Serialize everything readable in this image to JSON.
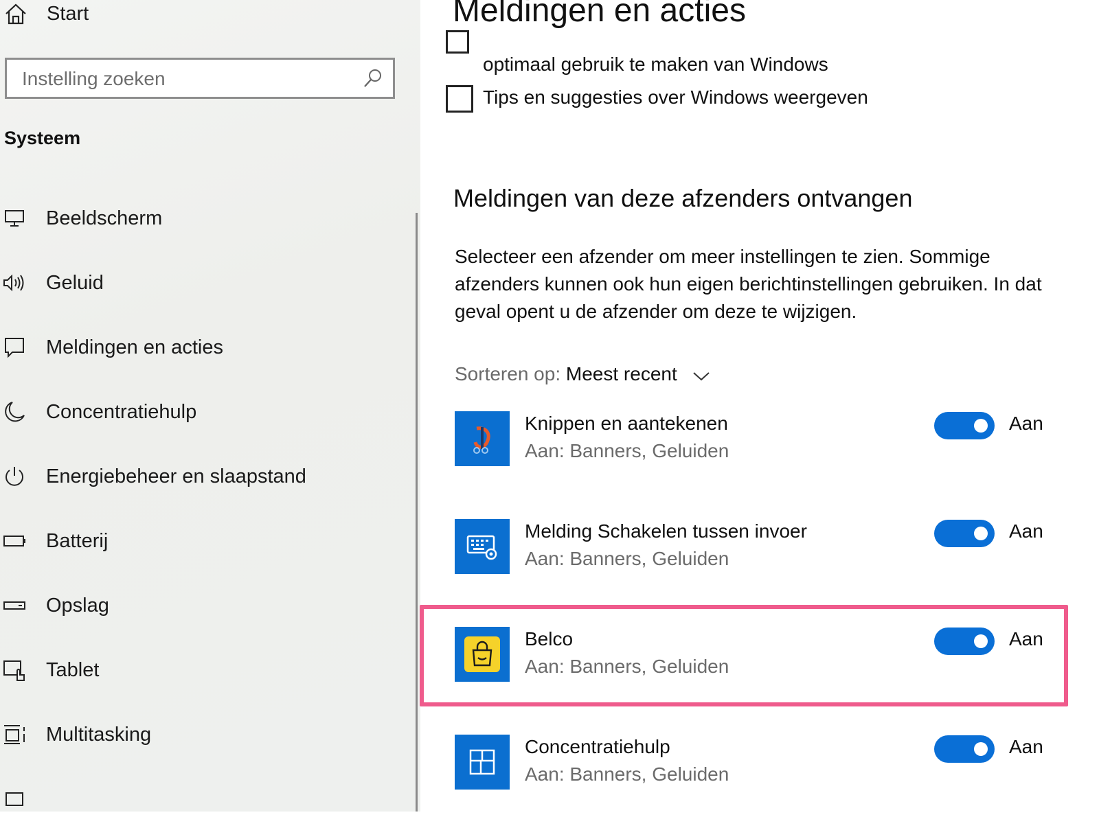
{
  "sidebar": {
    "home_label": "Start",
    "search": {
      "placeholder": "Instelling zoeken"
    },
    "section_heading": "Systeem",
    "items": [
      {
        "label": "Beeldscherm",
        "icon": "monitor-icon"
      },
      {
        "label": "Geluid",
        "icon": "speaker-icon"
      },
      {
        "label": "Meldingen en acties",
        "icon": "notification-icon"
      },
      {
        "label": "Concentratiehulp",
        "icon": "moon-icon"
      },
      {
        "label": "Energiebeheer en slaapstand",
        "icon": "power-icon"
      },
      {
        "label": "Batterij",
        "icon": "battery-icon"
      },
      {
        "label": "Opslag",
        "icon": "storage-icon"
      },
      {
        "label": "Tablet",
        "icon": "tablet-icon"
      },
      {
        "label": "Multitasking",
        "icon": "multitasking-icon"
      }
    ]
  },
  "main": {
    "title": "Meldingen en acties",
    "checkboxes": [
      {
        "label": "optimaal gebruik te maken van Windows",
        "checked": false
      },
      {
        "label": "Tips en suggesties over Windows weergeven",
        "checked": false
      }
    ],
    "senders_heading": "Meldingen van deze afzenders ontvangen",
    "description": "Selecteer een afzender om meer instellingen te zien. Sommige afzenders kunnen ook hun eigen berichtinstellingen gebruiken. In dat geval opent u de afzender om deze te wijzigen.",
    "sort": {
      "label": "Sorteren op:",
      "value": "Meest recent"
    },
    "senders": [
      {
        "name": "Knippen en aantekenen",
        "detail": "Aan: Banners, Geluiden",
        "state": "Aan",
        "on": true,
        "icon": "snip-sketch-icon",
        "icon_bg": "#0b6fd0"
      },
      {
        "name": "Melding Schakelen tussen invoer",
        "detail": "Aan: Banners, Geluiden",
        "state": "Aan",
        "on": true,
        "icon": "keyboard-settings-icon",
        "icon_bg": "#0b6fd0"
      },
      {
        "name": "Belco",
        "detail": "Aan: Banners, Geluiden",
        "state": "Aan",
        "on": true,
        "icon": "shopping-bag-icon",
        "icon_bg": "#0b6fd0"
      },
      {
        "name": "Concentratiehulp",
        "detail": "Aan: Banners, Geluiden",
        "state": "Aan",
        "on": true,
        "icon": "focus-assist-icon",
        "icon_bg": "#0b6fd0"
      }
    ]
  },
  "colors": {
    "accent": "#0a6fd6",
    "highlight": "#ef5b8c",
    "belco_yellow": "#f5d22a"
  }
}
